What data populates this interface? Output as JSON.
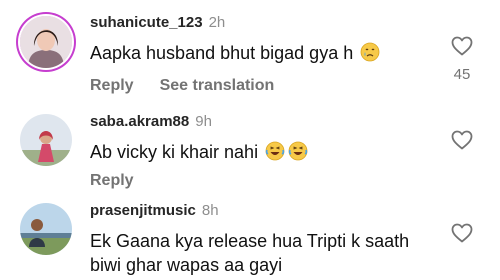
{
  "comments": [
    {
      "username": "suhanicute_123",
      "time": "2h",
      "text": "Aapka husband bhut bigad gya h",
      "emoji": "crying-face",
      "reply_label": "Reply",
      "translation_label": "See translation",
      "like_count": "45"
    },
    {
      "username": "saba.akram88",
      "time": "9h",
      "text": "Ab vicky ki khair nahi",
      "emoji": "laughing-face",
      "reply_label": "Reply"
    },
    {
      "username": "prasenjitmusic",
      "time": "8h",
      "text": "Ek Gaana kya release hua Tripti k saath biwi ghar wapas aa gayi"
    }
  ]
}
